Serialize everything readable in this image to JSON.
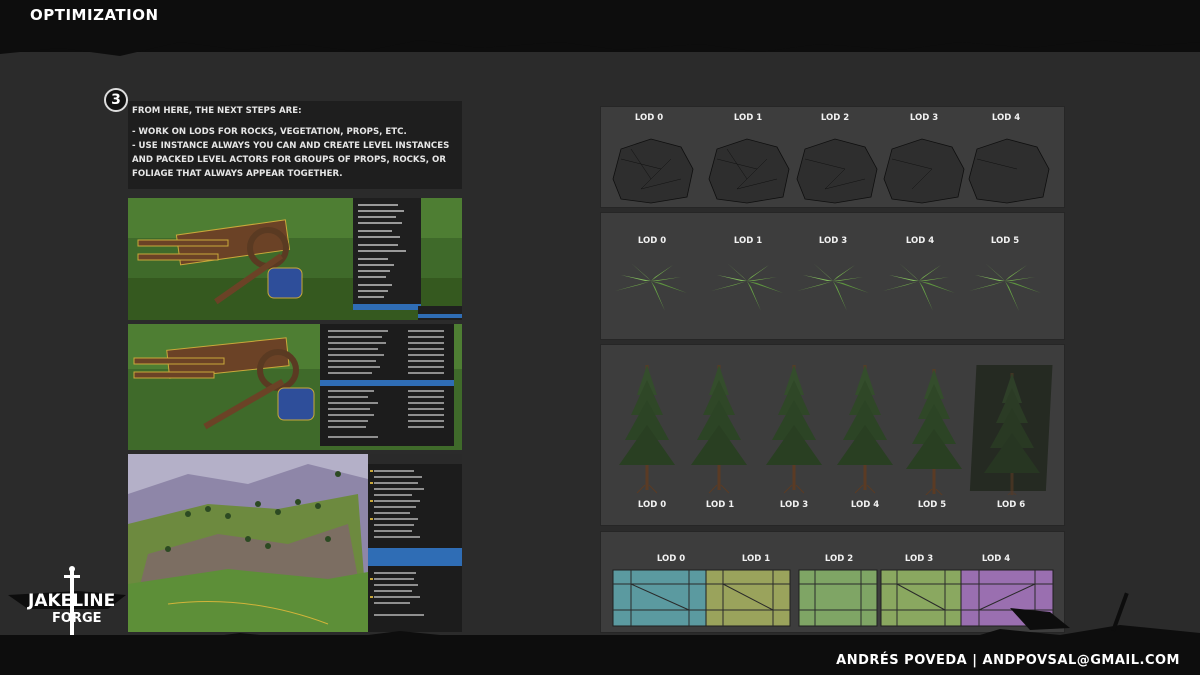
{
  "header": {
    "title": "OPTIMIZATION"
  },
  "step": {
    "number": "3",
    "intro": "FROM HERE, THE NEXT STEPS ARE:",
    "items": [
      "- WORK ON LODS FOR ROCKS, VEGETATION, PROPS, ETC.",
      "- USE INSTANCE ALWAYS YOU CAN AND CREATE LEVEL INSTANCES AND PACKED LEVEL ACTORS FOR GROUPS OF PROPS, ROCKS, OR FOLIAGE THAT ALWAYS APPEAR TOGETHER."
    ]
  },
  "lod_panels": {
    "rocks": [
      "LOD 0",
      "LOD 1",
      "LOD 2",
      "LOD 3",
      "LOD 4"
    ],
    "plants": [
      "LOD 0",
      "LOD 1",
      "LOD 3",
      "LOD 4",
      "LOD 5"
    ],
    "trees": [
      "LOD 0",
      "LOD 1",
      "LOD 3",
      "LOD 4",
      "LOD 5",
      "LOD 6"
    ],
    "crates": [
      "LOD 0",
      "LOD 1",
      "LOD 2",
      "LOD 3",
      "LOD 4"
    ]
  },
  "logo": {
    "line1": "JAKELINE",
    "line2": "FORGE"
  },
  "footer": {
    "author": "ANDRÉS POVEDA | ANDPOVSAL@GMAIL.COM"
  },
  "colors": {
    "background": "#2b2b2b",
    "bar": "#0d0d0d",
    "panel": "#3d3d3d",
    "crate_teal": "#5b9aa0",
    "crate_olive": "#9aa35c",
    "crate_green": "#7fa565",
    "crate_purple": "#9a6fb0"
  }
}
